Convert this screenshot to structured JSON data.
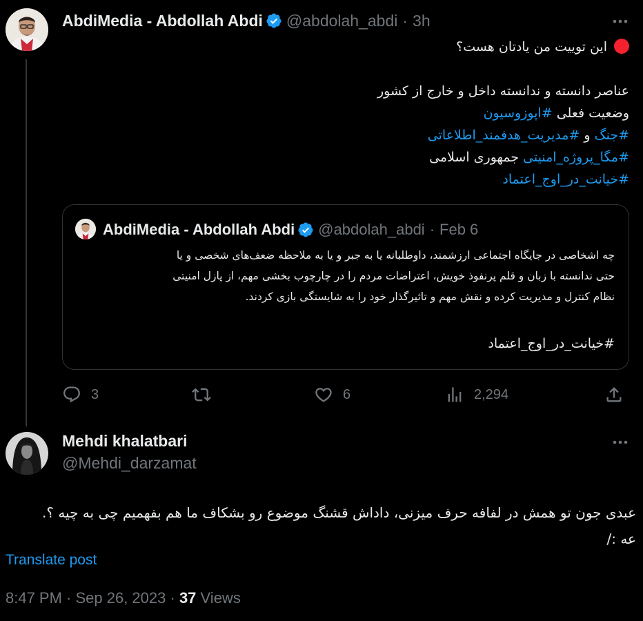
{
  "main_tweet": {
    "author_name": "AbdiMedia - Abdollah Abdi",
    "handle": "@abdolah_abdi",
    "separator": "·",
    "time": "3h",
    "body": {
      "line1": "این توییت من یادتان هست؟",
      "line2": "عناصر دانسته و ندانسته داخل و خارج از کشور",
      "line3_text": "وضعیت فعلی ",
      "line3_hash": "#اپوزوسیون",
      "line4_hash1": "#جنگ",
      "line4_text": " و ",
      "line4_hash2": "#مدیریت_هدفمند_اطلاعاتی",
      "line5_hash": "#مگا_پروژه_امنیتی",
      "line5_text": " جمهوری اسلامی",
      "line6_hash": "#خیانت_در_اوج_اعتماد"
    },
    "quote": {
      "author_name": "AbdiMedia - Abdollah Abdi",
      "handle": "@abdolah_abdi",
      "separator": "·",
      "date": "Feb 6",
      "line1": "چه اشخاصی در جایگاه اجتماعی ارزشمند، داوطلبانه یا به جبر و یا به ملاحظه ضعف‌های شخصی و یا",
      "line2": "حتی ندانسته با زبان و قلم پرنفوذ خویش، اعتراضات مردم را در چارچوب بخشی مهم، از پازل امنیتی",
      "line3": "نظام کنترل و مدیریت کرده و نقش مهم و تاثیرگذار خود را به شایستگی بازی کردند.",
      "hashtag": "#خیانت_در_اوج_اعتماد"
    },
    "actions": {
      "replies": "3",
      "likes": "6",
      "views": "2,294"
    }
  },
  "reply_tweet": {
    "author_name": "Mehdi khalatbari",
    "handle": "@Mehdi_darzamat",
    "line1": "عبدی جون تو همش در لفافه حرف میزنی، داداش قشنگ موضوع رو بشکاف ما هم بفهمیم چی به چیه ؟.",
    "line2": "عه :/",
    "translate_label": "Translate post",
    "timestamp": "8:47 PM · Sep 26, 2023 · ",
    "views_count": "37",
    "views_label": " Views"
  },
  "colors": {
    "background": "#000000",
    "text": "#e7e9ea",
    "muted": "#71767b",
    "accent": "#1d9bf0",
    "verified": "#1d9bf0",
    "red_dot": "#f4212e"
  },
  "icons": [
    "verified-badge-icon",
    "more-icon",
    "reply-icon",
    "retweet-icon",
    "like-icon",
    "views-icon",
    "share-icon",
    "red-circle-emoji"
  ]
}
